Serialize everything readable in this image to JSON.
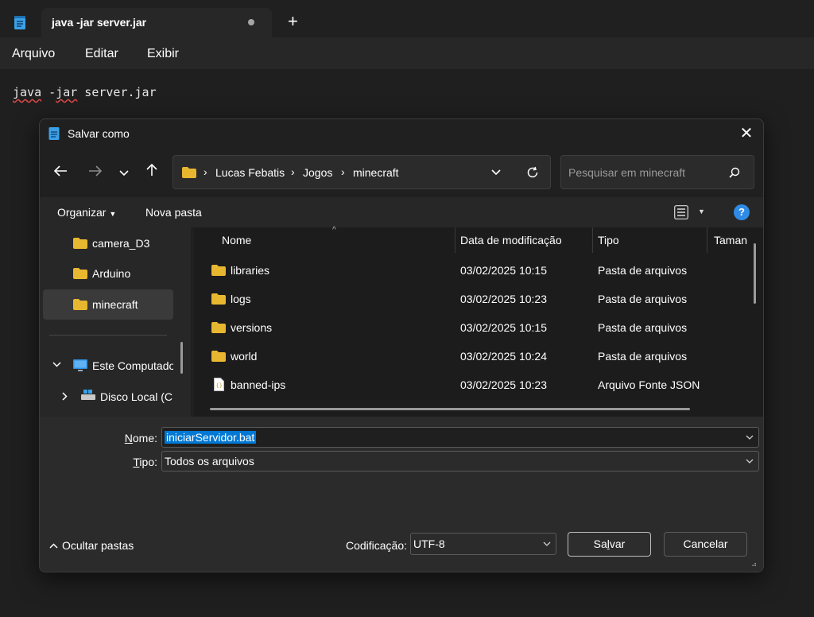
{
  "tab": {
    "title": "java -jar server.jar",
    "new_tab_symbol": "+"
  },
  "menu": {
    "items": [
      "Arquivo",
      "Editar",
      "Exibir"
    ]
  },
  "editor": {
    "word1": "java",
    "word2": " -",
    "word3": "jar",
    "word4": " server.jar"
  },
  "dialog": {
    "title": "Salvar como",
    "close_symbol": "✕",
    "breadcrumb": [
      "Lucas Febatis",
      "Jogos",
      "minecraft"
    ],
    "search_placeholder": "Pesquisar em minecraft",
    "toolbar": {
      "organize": "Organizar",
      "new_folder": "Nova pasta",
      "help": "?"
    },
    "sidebar": {
      "items": [
        "camera_D3",
        "Arduino",
        "minecraft"
      ],
      "this_pc": "Este Computador",
      "local_disk": "Disco Local (C:"
    },
    "columns": {
      "name": "Nome",
      "modified": "Data de modificação",
      "type": "Tipo",
      "size": "Taman"
    },
    "files": [
      {
        "name": "libraries",
        "modified": "03/02/2025 10:15",
        "type": "Pasta de arquivos",
        "icon": "folder-icon"
      },
      {
        "name": "logs",
        "modified": "03/02/2025 10:23",
        "type": "Pasta de arquivos",
        "icon": "folder-icon"
      },
      {
        "name": "versions",
        "modified": "03/02/2025 10:15",
        "type": "Pasta de arquivos",
        "icon": "folder-icon"
      },
      {
        "name": "world",
        "modified": "03/02/2025 10:24",
        "type": "Pasta de arquivos",
        "icon": "folder-icon"
      },
      {
        "name": "banned-ips",
        "modified": "03/02/2025 10:23",
        "type": "Arquivo Fonte JSON",
        "icon": "json-file-icon"
      }
    ],
    "form": {
      "name_label_u": "N",
      "name_label_rest": "ome:",
      "name_value": "iniciarServidor.bat",
      "type_label_u": "T",
      "type_label_rest": "ipo:",
      "type_value": "Todos os arquivos",
      "hide_folders": "Ocultar pastas",
      "encoding_label": "Codificação:",
      "encoding_value": "UTF-8",
      "save_pre": "Sa",
      "save_u": "l",
      "save_post": "var",
      "cancel": "Cancelar"
    }
  },
  "colors": {
    "folder": "#e8b730",
    "accent": "#0078d4",
    "help": "#2e8be6",
    "squiggle": "#e04848"
  }
}
